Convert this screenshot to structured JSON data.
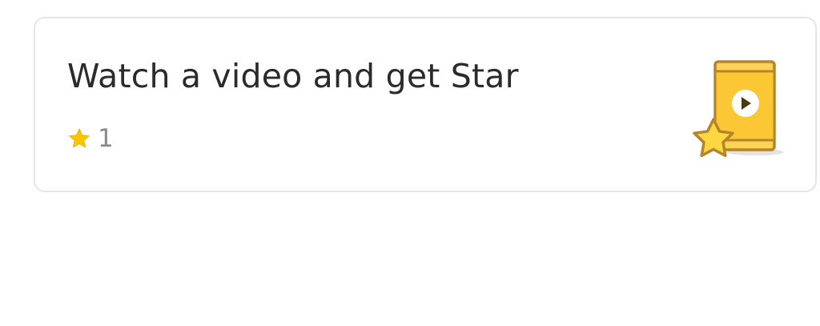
{
  "card": {
    "title": "Watch a video and get Star",
    "reward_count": "1"
  },
  "icons": {
    "reward_icon": "star-icon",
    "illustration": "phone-video-star-icon",
    "play": "play-icon"
  },
  "colors": {
    "star": "#f7c600",
    "phone_fill": "#fcc734",
    "phone_border": "#b5852a",
    "title_text": "#2b2b2b",
    "count_text": "#8a8a8a",
    "card_border": "#e6e6e6"
  }
}
